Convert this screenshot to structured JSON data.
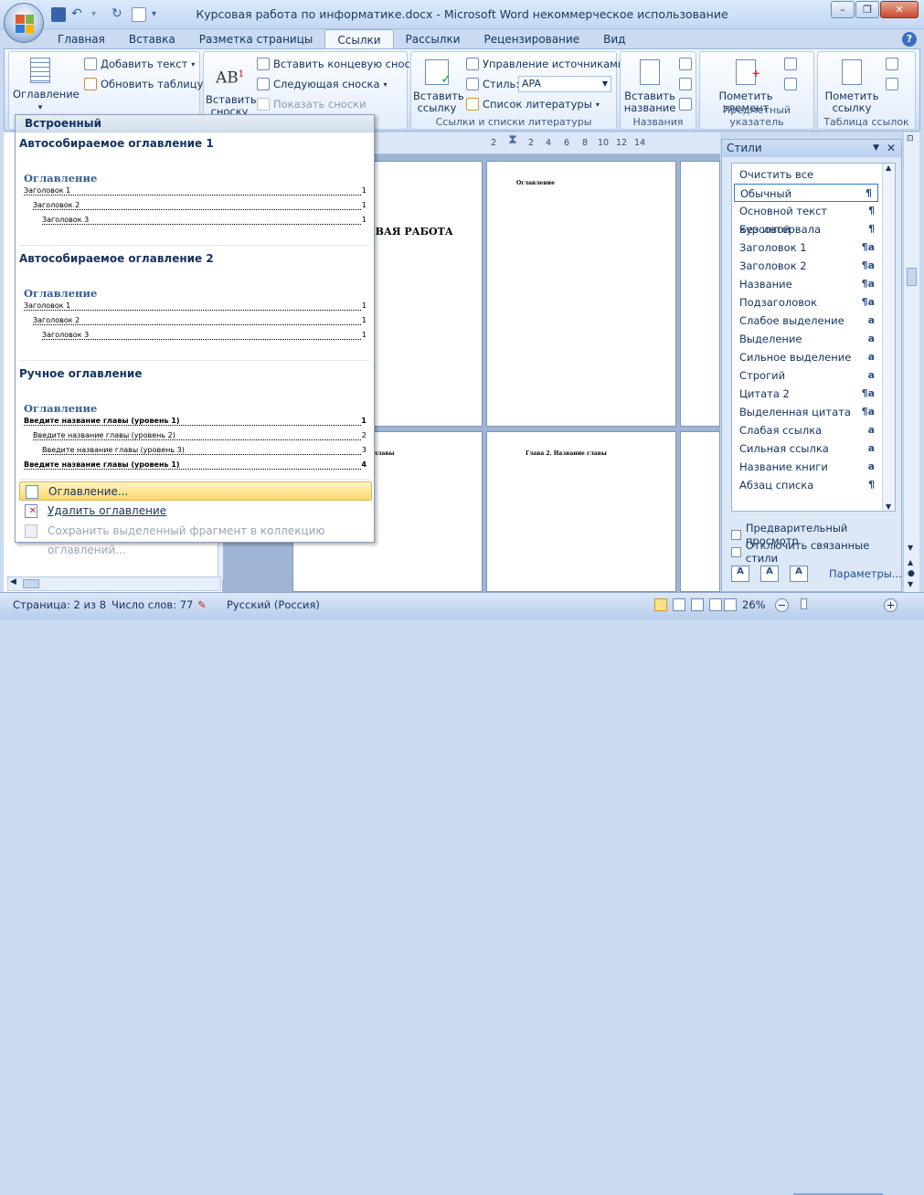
{
  "window": {
    "title": "Курсовая работа по информатике.docx - Microsoft Word некоммерческое использование",
    "accent": "#3d6fc1"
  },
  "tabs": [
    {
      "label": "Главная"
    },
    {
      "label": "Вставка"
    },
    {
      "label": "Разметка страницы"
    },
    {
      "label": "Ссылки",
      "active": true
    },
    {
      "label": "Рассылки"
    },
    {
      "label": "Рецензирование"
    },
    {
      "label": "Вид"
    }
  ],
  "ribbon": {
    "toc_group": {
      "toc_button": "Оглавление",
      "add_text": "Добавить текст",
      "update_table": "Обновить таблицу"
    },
    "footnotes_group": {
      "insert_footnote": "Вставить сноску",
      "insert_endnote": "Вставить концевую сноску",
      "next_footnote": "Следующая сноска",
      "show_notes": "Показать сноски",
      "icon_text": "AB",
      "icon_sup": "1"
    },
    "citations_group": {
      "insert_citation": "Вставить ссылку",
      "manage_sources": "Управление источниками",
      "style_label": "Стиль:",
      "style_value": "APA",
      "bibliography": "Список литературы",
      "group_label": "Ссылки и списки литературы"
    },
    "captions_group": {
      "insert_caption": "Вставить название",
      "group_label": "Названия"
    },
    "index_group": {
      "mark_entry": "Пометить элемент",
      "group_label": "Предметный указатель"
    },
    "toa_group": {
      "mark_citation": "Пометить ссылку",
      "group_label": "Таблица ссылок"
    }
  },
  "toc_dropdown": {
    "header": "Встроенный",
    "sections": [
      {
        "title": "Автособираемое оглавление 1",
        "heading": "Оглавление",
        "lines": [
          {
            "text": "Заголовок 1",
            "page": "1"
          },
          {
            "text": "Заголовок 2",
            "page": "1"
          },
          {
            "text": "Заголовок 3",
            "page": "1"
          }
        ]
      },
      {
        "title": "Автособираемое оглавление 2",
        "heading": "Оглавление",
        "lines": [
          {
            "text": "Заголовок 1",
            "page": "1"
          },
          {
            "text": "Заголовок 2",
            "page": "1"
          },
          {
            "text": "Заголовок 3",
            "page": "1"
          }
        ]
      },
      {
        "title": "Ручное оглавление",
        "heading": "Оглавление",
        "lines": [
          {
            "text": "Введите название главы (уровень 1)",
            "page": "1"
          },
          {
            "text": "Введите название главы (уровень 2)",
            "page": "2"
          },
          {
            "text": "Введите название главы (уровень 3)",
            "page": "3"
          },
          {
            "text": "Введите название главы (уровень 1)",
            "page": "4"
          }
        ]
      }
    ],
    "menu": {
      "toc_dialog": "Оглавление...",
      "remove_toc": "Удалить оглавление",
      "save_selection": "Сохранить выделенный фрагмент в коллекцию оглавлений..."
    }
  },
  "ruler": {
    "ticks": [
      "2",
      "2",
      "4",
      "6",
      "8",
      "10",
      "12",
      "14"
    ]
  },
  "document": {
    "page1_title": "ОВАЯ РАБОТА",
    "page2_heading": "Оглавление",
    "page4_heading": "ллавы",
    "page5_heading": "Глава 2. Название главы"
  },
  "styles_pane": {
    "title": "Стили",
    "items": [
      {
        "label": "Очистить все",
        "mark": ""
      },
      {
        "label": "Обычный",
        "mark": "¶",
        "selected": true
      },
      {
        "label": "Основной текст курсовой",
        "mark": "¶"
      },
      {
        "label": "Без интервала",
        "mark": "¶"
      },
      {
        "label": "Заголовок 1",
        "mark": "¶a"
      },
      {
        "label": "Заголовок 2",
        "mark": "¶a"
      },
      {
        "label": "Название",
        "mark": "¶a"
      },
      {
        "label": "Подзаголовок",
        "mark": "¶a"
      },
      {
        "label": "Слабое выделение",
        "mark": "a"
      },
      {
        "label": "Выделение",
        "mark": "a"
      },
      {
        "label": "Сильное выделение",
        "mark": "a"
      },
      {
        "label": "Строгий",
        "mark": "a"
      },
      {
        "label": "Цитата 2",
        "mark": "¶a"
      },
      {
        "label": "Выделенная цитата",
        "mark": "¶a"
      },
      {
        "label": "Слабая ссылка",
        "mark": "a"
      },
      {
        "label": "Сильная ссылка",
        "mark": "a"
      },
      {
        "label": "Название книги",
        "mark": "a"
      },
      {
        "label": "Абзац списка",
        "mark": "¶"
      }
    ],
    "preview_checkbox": "Предварительный просмотр",
    "linked_checkbox": "Отключить связанные стили",
    "options_link": "Параметры..."
  },
  "statusbar": {
    "page": "Страница: 2 из 8",
    "words": "Число слов: 77",
    "language": "Русский (Россия)",
    "zoom": "26%"
  }
}
